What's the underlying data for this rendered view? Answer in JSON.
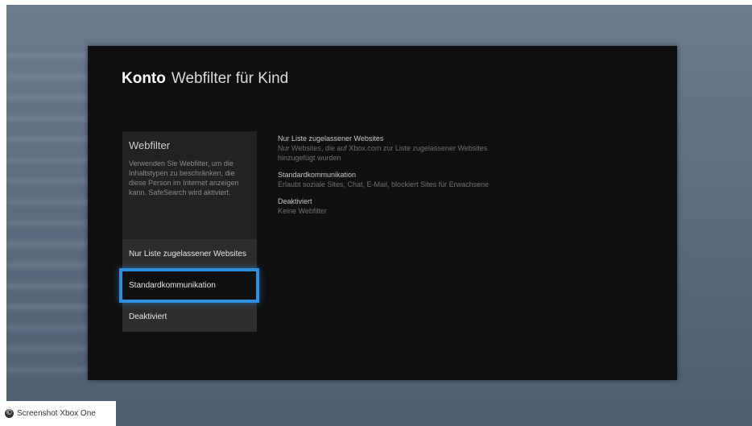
{
  "title": {
    "app": "Konto",
    "page": "Webfilter für Kind"
  },
  "panel": {
    "heading": "Webfilter",
    "description": "Verwenden Sie Webfilter, um die Inhaltstypen zu beschränken, die diese Person im Internet anzeigen kann. SafeSearch wird aktiviert.",
    "options": [
      {
        "label": "Nur Liste zugelassener Websites"
      },
      {
        "label": "Standardkommunikation"
      },
      {
        "label": "Deaktiviert"
      }
    ],
    "selected_option": "Standardkommunikation"
  },
  "info": [
    {
      "title": "Nur Liste zugelassener Websites",
      "desc": "Nur Websites, die auf Xbox.com zur Liste zugelassener Websites hinzugefügt wurden"
    },
    {
      "title": "Standardkommunikation",
      "desc": "Erlaubt soziale Sites, Chat, E-Mail, blockiert Sites für Erwachsene"
    },
    {
      "title": "Deaktiviert",
      "desc": "Keine Webfilter"
    }
  ],
  "caption": {
    "icon": "copyright-icon",
    "text": "Screenshot Xbox One"
  },
  "colors": {
    "focus": "#2d8fe0",
    "dialog_bg": "#101010"
  }
}
